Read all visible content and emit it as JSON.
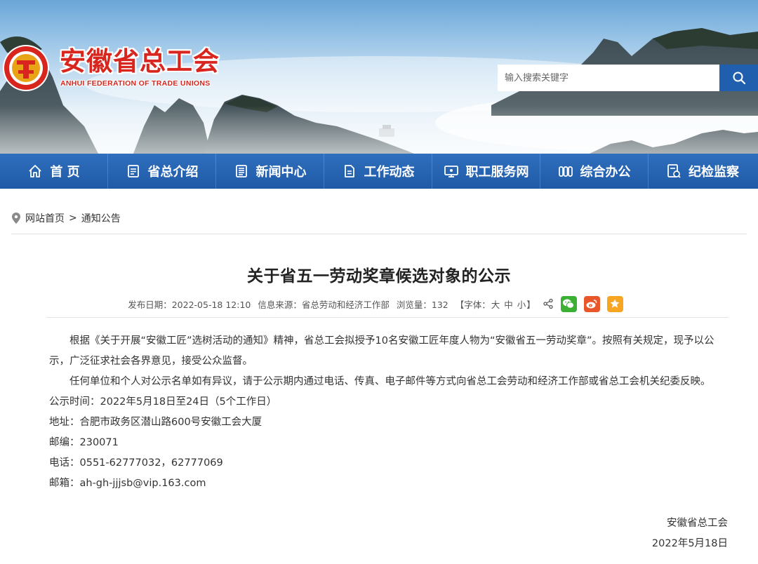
{
  "header": {
    "org_name_cn": "安徽省总工会",
    "org_name_en": "ANHUI FEDERATION OF TRADE UNIONS",
    "search_placeholder": "输入搜索关键字",
    "brand_red": "#d8261f",
    "nav_blue": "#1f5aa6"
  },
  "nav": {
    "items": [
      {
        "label": "首 页",
        "icon": "home-icon"
      },
      {
        "label": "省总介绍",
        "icon": "document-list-icon"
      },
      {
        "label": "新闻中心",
        "icon": "news-icon"
      },
      {
        "label": "工作动态",
        "icon": "file-icon"
      },
      {
        "label": "职工服务网",
        "icon": "monitor-icon"
      },
      {
        "label": "综合办公",
        "icon": "columns-icon"
      },
      {
        "label": "纪检监察",
        "icon": "inspection-icon"
      }
    ]
  },
  "breadcrumb": {
    "home": "网站首页",
    "separator": ">",
    "current": "通知公告"
  },
  "article": {
    "title": "关于省五一劳动奖章候选对象的公示",
    "meta": {
      "date": "发布日期：2022-05-18 12:10",
      "source": "信息来源：省总劳动和经济工作部",
      "views": "浏览量：132",
      "font_label": "【字体：",
      "font_large": "大",
      "font_medium": "中",
      "font_small": "小",
      "font_close": "】"
    },
    "paragraph1": "根据《关于开展“安徽工匠”选树活动的通知》精神，省总工会拟授予10名安徽工匠年度人物为“安徽省五一劳动奖章”。按照有关规定，现予以公示，广泛征求社会各界意见，接受公众监督。",
    "paragraph2": "任何单位和个人对公示名单如有异议，请于公示期内通过电话、传真、电子邮件等方式向省总工会劳动和经济工作部或省总工会机关纪委反映。",
    "period": "公示时间：2022年5月18日至24日（5个工作日）",
    "address": "地址：合肥市政务区潜山路600号安徽工会大厦",
    "postcode": "邮编：230071",
    "phone": "电话：0551-62777032，62777069",
    "email": "邮箱：ah-gh-jjjsb@vip.163.com",
    "signature": "安徽省总工会",
    "sign_date": "2022年5月18日"
  },
  "share": {
    "wechat_color": "#3cb034",
    "weibo_color": "#e8562a",
    "favorite_color": "#f6a623"
  }
}
